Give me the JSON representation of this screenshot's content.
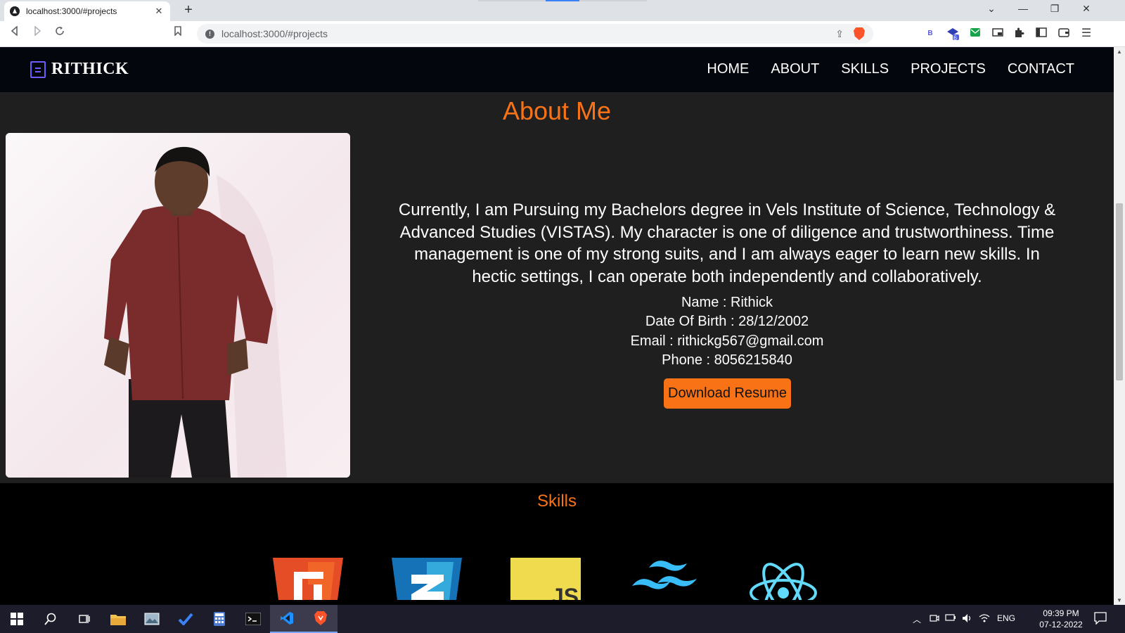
{
  "browser": {
    "tab_title": "localhost:3000/#projects",
    "tab_close": "✕",
    "new_tab": "+",
    "url": "localhost:3000/#projects",
    "window_controls": [
      "⌄",
      "—",
      "❐",
      "✕"
    ],
    "extension_badge": "6"
  },
  "site": {
    "brand": "RITHICK",
    "nav": [
      "HOME",
      "ABOUT",
      "SKILLS",
      "PROJECTS",
      "CONTACT"
    ],
    "accent_color": "#f97316",
    "brand_icon_color": "#6f5bff"
  },
  "about": {
    "title": "About Me",
    "paragraph": "Currently, I am Pursuing my Bachelors degree in Vels Institute of Science, Technology & Advanced Studies (VISTAS). My character is one of diligence and trustworthiness. Time management is one of my strong suits, and I am always eager to learn new skills. In hectic settings, I can operate both independently and collaboratively.",
    "name": "Name : Rithick",
    "dob": "Date Of Birth : 28/12/2002",
    "email": "Email : rithickg567@gmail.com",
    "phone": "Phone : 8056215840",
    "resume_button": "Download Resume"
  },
  "skills": {
    "title": "Skills",
    "icons": [
      "html5-icon",
      "css3-icon",
      "javascript-icon",
      "tailwind-icon",
      "react-icon"
    ],
    "js_label": "JS"
  },
  "taskbar": {
    "language": "ENG",
    "time": "09:39 PM",
    "date": "07-12-2022"
  }
}
